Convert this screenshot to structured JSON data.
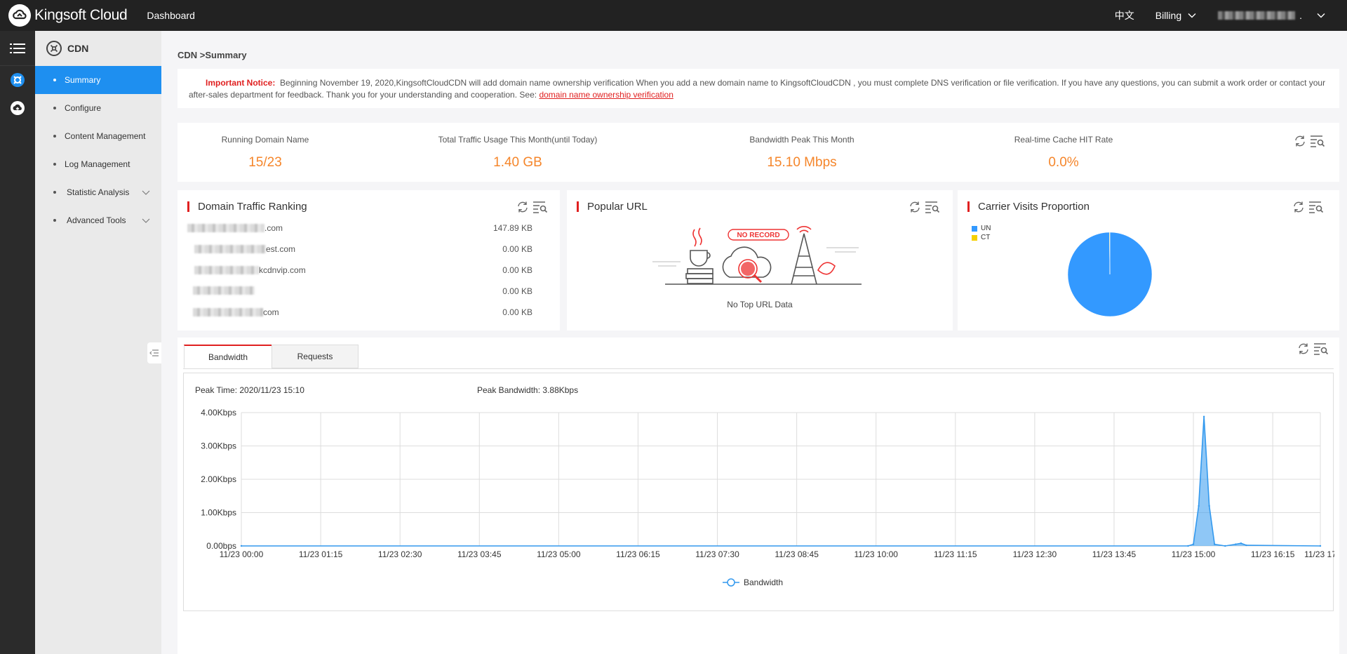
{
  "topbar": {
    "brand": "Kingsoft Cloud",
    "dashboard": "Dashboard",
    "language": "中文",
    "billing": "Billing"
  },
  "sidemenu": {
    "section": "CDN",
    "items": [
      {
        "label": "Summary",
        "active": true
      },
      {
        "label": "Configure"
      },
      {
        "label": "Content Management"
      },
      {
        "label": "Log Management"
      },
      {
        "label": "Statistic Analysis",
        "expandable": true
      },
      {
        "label": "Advanced Tools",
        "expandable": true
      }
    ]
  },
  "breadcrumb": "CDN >Summary",
  "notice": {
    "label": "Important Notice:",
    "text": "Beginning November 19, 2020,KingsoftCloudCDN will add domain name ownership verification When you add a new domain name to KingsoftCloudCDN , you must complete DNS verification or file verification. If you have any questions, you can submit a work order or contact your after-sales department for feedback. Thank you for your understanding and cooperation. See:",
    "link": "domain name ownership verification"
  },
  "stats": [
    {
      "label": "Running Domain Name",
      "value": "15/23"
    },
    {
      "label": "Total Traffic Usage This Month(until Today)",
      "value": "1.40 GB"
    },
    {
      "label": "Bandwidth Peak This Month",
      "value": "15.10 Mbps"
    },
    {
      "label": "Real-time Cache HIT Rate",
      "value": "0.0%"
    }
  ],
  "domain_ranking": {
    "title": "Domain Traffic Ranking",
    "rows": [
      {
        "suffix": ".com",
        "value": "147.89 KB"
      },
      {
        "suffix": "est.com",
        "value": "0.00 KB"
      },
      {
        "suffix": "kcdnvip.com",
        "value": "0.00 KB"
      },
      {
        "suffix": "",
        "value": "0.00 KB"
      },
      {
        "suffix": "com",
        "value": "0.00 KB"
      }
    ]
  },
  "popular_url": {
    "title": "Popular URL",
    "badge": "NO RECORD",
    "empty_text": "No Top URL Data"
  },
  "carrier": {
    "title": "Carrier Visits Proportion",
    "legend": [
      {
        "label": "UN",
        "color": "#3399ff"
      },
      {
        "label": "CT",
        "color": "#f5d000"
      }
    ],
    "slices": [
      {
        "label": "UN",
        "value": 99.8,
        "color": "#3399ff"
      },
      {
        "label": "CT",
        "value": 0.2,
        "color": "#f5d000"
      }
    ]
  },
  "bandwidth": {
    "tabs": [
      "Bandwidth",
      "Requests"
    ],
    "peak_time": "Peak Time: 2020/11/23 15:10",
    "peak_bandwidth": "Peak Bandwidth: 3.88Kbps"
  },
  "chart_data": {
    "type": "area",
    "title": "",
    "xlabel": "",
    "ylabel": "",
    "x_ticks": [
      "11/23 00:00",
      "11/23 01:15",
      "11/23 02:30",
      "11/23 03:45",
      "11/23 05:00",
      "11/23 06:15",
      "11/23 07:30",
      "11/23 08:45",
      "11/23 10:00",
      "11/23 11:15",
      "11/23 12:30",
      "11/23 13:45",
      "11/23 15:00",
      "11/23 16:15",
      "11/23 17"
    ],
    "y_ticks": [
      "0.00bps",
      "1.00Kbps",
      "2.00Kbps",
      "3.00Kbps",
      "4.00Kbps"
    ],
    "ylim": [
      0,
      4
    ],
    "y_unit": "Kbps",
    "grid": true,
    "legend_position": "bottom",
    "series": [
      {
        "name": "Bandwidth",
        "color": "#3399ee",
        "points": [
          [
            "11/23 00:00",
            0
          ],
          [
            "11/23 14:55",
            0
          ],
          [
            "11/23 15:00",
            0.05
          ],
          [
            "11/23 15:05",
            1.2
          ],
          [
            "11/23 15:10",
            3.88
          ],
          [
            "11/23 15:15",
            1.2
          ],
          [
            "11/23 15:20",
            0.05
          ],
          [
            "11/23 15:30",
            0
          ],
          [
            "11/23 15:40",
            0.05
          ],
          [
            "11/23 15:45",
            0.08
          ],
          [
            "11/23 15:50",
            0.02
          ],
          [
            "11/23 17:00",
            0
          ]
        ]
      }
    ]
  }
}
